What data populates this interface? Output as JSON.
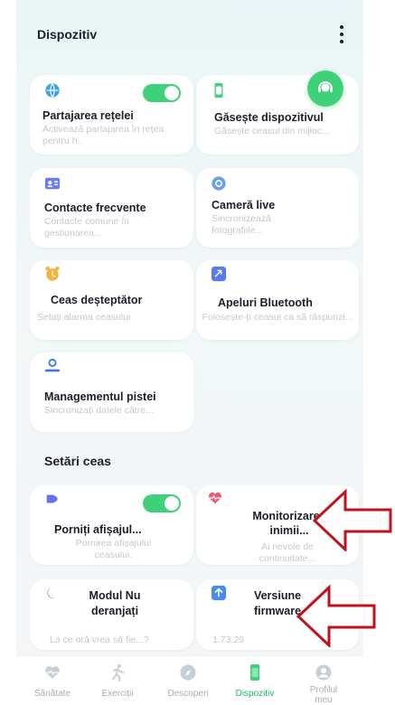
{
  "header": {
    "title": "Dispozitiv"
  },
  "cards": {
    "network": {
      "title": "Partajarea rețelei",
      "desc": "Activează partajarea în rețea pentru h..",
      "toggle": "on"
    },
    "find": {
      "title": "Găsește dispozitivul",
      "desc": "Găsește ceasul din mijloc..."
    },
    "contacts": {
      "title": "Contacte frecvente",
      "desc": "Contacte comune în gestionarea..."
    },
    "camera": {
      "title": "Cameră live",
      "desc": "Sincronizează fotografiile..."
    },
    "alarm": {
      "title": "Ceas deșteptător",
      "desc": "Setați alarma ceasului"
    },
    "bluetooth": {
      "title": "Apeluri Bluetooth",
      "desc": "Folosește-ți ceasul ca să răspunzi..."
    },
    "track": {
      "title": "Managementul pistei",
      "desc": "Sincronizați datele către..."
    }
  },
  "settings": {
    "title": "Setări ceas",
    "display": {
      "title": "Porniți afișajul...",
      "desc": "Pornirea afișajului ceasului.",
      "toggle": "on"
    },
    "heart": {
      "title": "Monitorizarea inimii...",
      "desc": "Ai nevoie de continuitate..."
    },
    "dnd": {
      "title": "Modul Nu deranjați",
      "desc": "La ce oră vrea să fie...?"
    },
    "firmware": {
      "title": "Versiune firmware",
      "version": "1.73.29"
    }
  },
  "tabs": [
    {
      "label": "Sănătate",
      "icon": "heart-pulse-icon",
      "active": false
    },
    {
      "label": "Exerciții",
      "icon": "running-icon",
      "active": false
    },
    {
      "label": "Descoperi",
      "icon": "compass-icon",
      "active": false
    },
    {
      "label": "Dispozitiv",
      "icon": "watch-icon",
      "active": true
    },
    {
      "label": "Profilul meu",
      "icon": "profile-icon",
      "active": false
    }
  ],
  "colors": {
    "accent": "#3ed17a",
    "arrow": "#c0121b",
    "active_tab": "#22b46a"
  }
}
